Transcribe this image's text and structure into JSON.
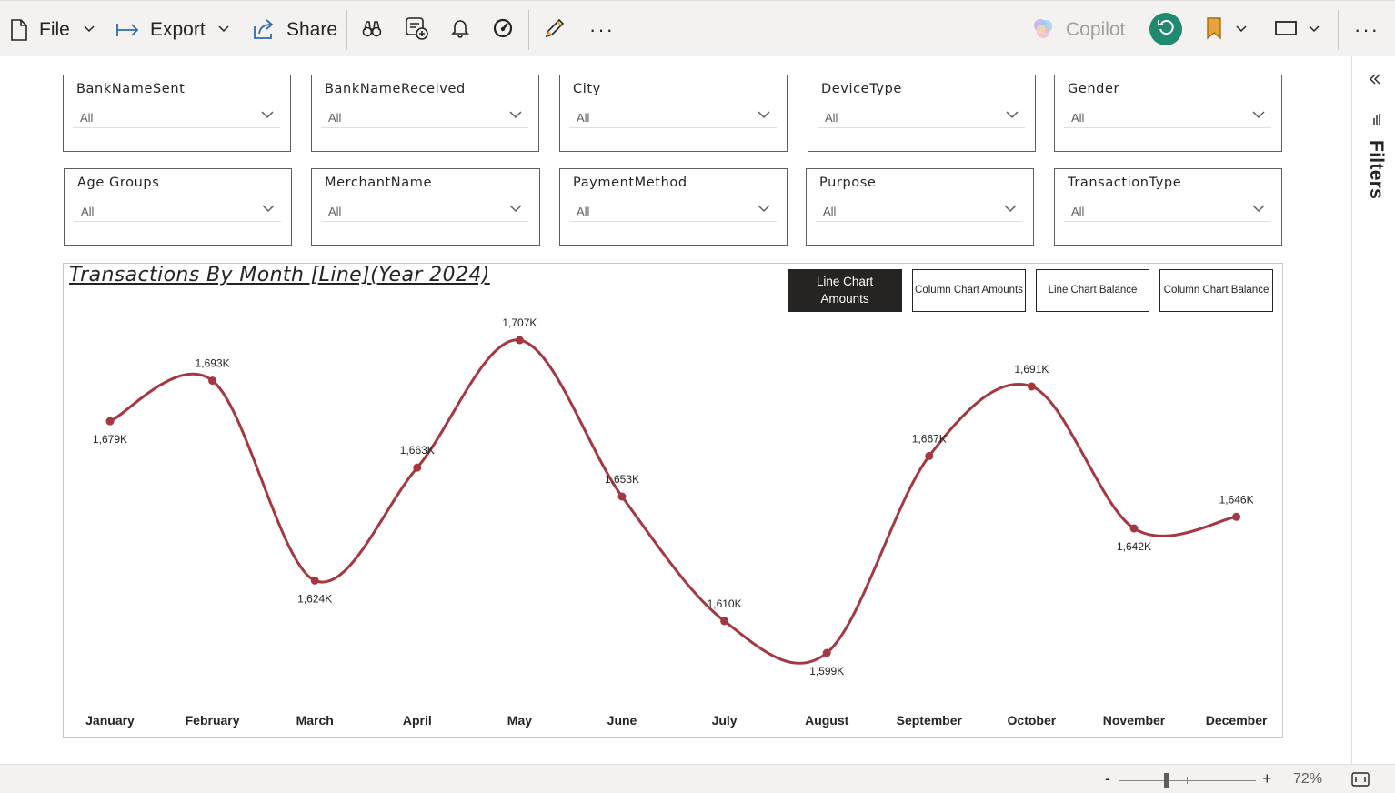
{
  "toolbar": {
    "file_label": "File",
    "export_label": "Export",
    "share_label": "Share",
    "copilot_label": "Copilot",
    "icons": [
      "file-icon",
      "export-icon",
      "share-icon",
      "binoculars-icon",
      "add-subscription-icon",
      "bell-icon",
      "performance-icon",
      "edit-pencil-icon",
      "more-icon",
      "copilot-icon",
      "reset-icon",
      "bookmark-icon",
      "view-icon",
      "more-icon"
    ],
    "colors": {
      "avatar": "#1f8a70",
      "bookmark": "#e8a33d",
      "accent": "#2b6cb0"
    }
  },
  "slicers": [
    {
      "title": "BankNameSent",
      "value": "All"
    },
    {
      "title": "BankNameReceived",
      "value": "All"
    },
    {
      "title": "City",
      "value": "All"
    },
    {
      "title": "DeviceType",
      "value": "All"
    },
    {
      "title": "Gender",
      "value": "All"
    },
    {
      "title": "Age Groups",
      "value": "All"
    },
    {
      "title": "MerchantName",
      "value": "All"
    },
    {
      "title": "PaymentMethod",
      "value": "All"
    },
    {
      "title": "Purpose",
      "value": "All"
    },
    {
      "title": "TransactionType",
      "value": "All"
    }
  ],
  "visual": {
    "title": "Transactions By Month [Line](Year 2024)",
    "buttons": [
      {
        "label": "Line Chart Amounts",
        "active": true
      },
      {
        "label": "Column Chart Amounts",
        "active": false
      },
      {
        "label": "Line Chart Balance",
        "active": false
      },
      {
        "label": "Column Chart Balance",
        "active": false
      }
    ]
  },
  "chart_data": {
    "type": "line",
    "title": "Transactions By Month [Line](Year 2024)",
    "xlabel": "",
    "ylabel": "",
    "categories": [
      "January",
      "February",
      "March",
      "April",
      "May",
      "June",
      "July",
      "August",
      "September",
      "October",
      "November",
      "December"
    ],
    "values": [
      1679,
      1693,
      1624,
      1663,
      1707,
      1653,
      1610,
      1599,
      1667,
      1691,
      1642,
      1646
    ],
    "data_labels": [
      "1,679K",
      "1,693K",
      "1,624K",
      "1,663K",
      "1,707K",
      "1,653K",
      "1,610K",
      "1,599K",
      "1,667K",
      "1,691K",
      "1,642K",
      "1,646K"
    ],
    "label_positions": [
      "below",
      "above",
      "below",
      "above",
      "above",
      "above",
      "above",
      "below",
      "above",
      "above",
      "below",
      "above"
    ],
    "smooth": true,
    "grid": false,
    "y_axis_visible": false,
    "line_color": "#a4373f"
  },
  "filters_pane": {
    "label": "Filters"
  },
  "status": {
    "zoom_label": "72%",
    "zoom_value": 72
  }
}
